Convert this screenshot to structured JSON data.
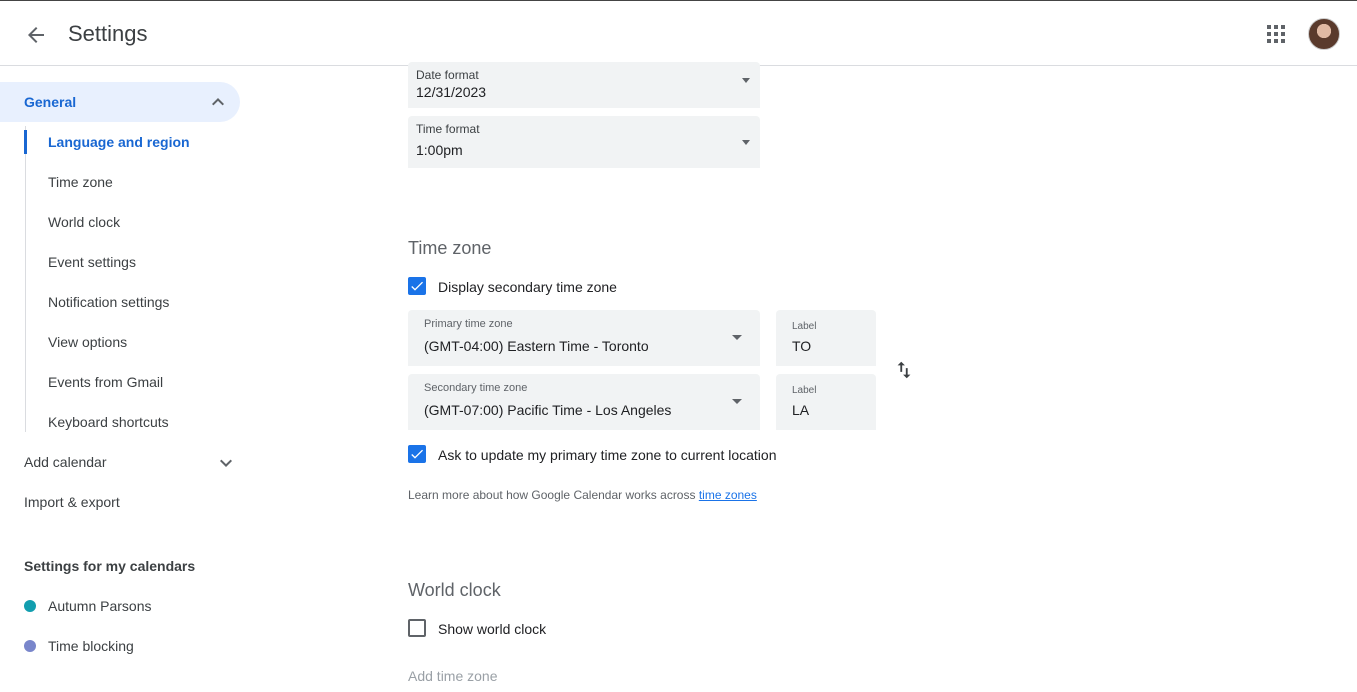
{
  "header": {
    "title": "Settings"
  },
  "sidebar": {
    "general": {
      "label": "General"
    },
    "general_items": [
      {
        "label": "Language and region"
      },
      {
        "label": "Time zone"
      },
      {
        "label": "World clock"
      },
      {
        "label": "Event settings"
      },
      {
        "label": "Notification settings"
      },
      {
        "label": "View options"
      },
      {
        "label": "Events from Gmail"
      },
      {
        "label": "Keyboard shortcuts"
      }
    ],
    "add_calendar": {
      "label": "Add calendar"
    },
    "import_export": {
      "label": "Import & export"
    },
    "my_calendars": {
      "heading": "Settings for my calendars",
      "items": [
        {
          "label": "Autumn Parsons",
          "color": "#129eaf"
        },
        {
          "label": "Time blocking",
          "color": "#7986cb"
        }
      ]
    }
  },
  "main": {
    "date_format": {
      "label": "Date format",
      "value": "12/31/2023"
    },
    "time_format": {
      "label": "Time format",
      "value": "1:00pm"
    },
    "time_zone": {
      "heading": "Time zone",
      "display_secondary": {
        "label": "Display secondary time zone",
        "checked": true
      },
      "primary": {
        "label": "Primary time zone",
        "value": "(GMT-04:00) Eastern Time - Toronto",
        "tag_label": "Label",
        "tag_value": "TO"
      },
      "secondary": {
        "label": "Secondary time zone",
        "value": "(GMT-07:00) Pacific Time - Los Angeles",
        "tag_label": "Label",
        "tag_value": "LA"
      },
      "ask_update": {
        "label": "Ask to update my primary time zone to current location",
        "checked": true
      },
      "helper_text": "Learn more about how Google Calendar works across ",
      "helper_link": "time zones"
    },
    "world_clock": {
      "heading": "World clock",
      "show": {
        "label": "Show world clock",
        "checked": false
      },
      "add_time_zone": "Add time zone"
    }
  },
  "colors": {
    "accent": "#1a73e8",
    "active_nav_bg": "#e8f0fe",
    "active_nav_text": "#1967d2"
  }
}
